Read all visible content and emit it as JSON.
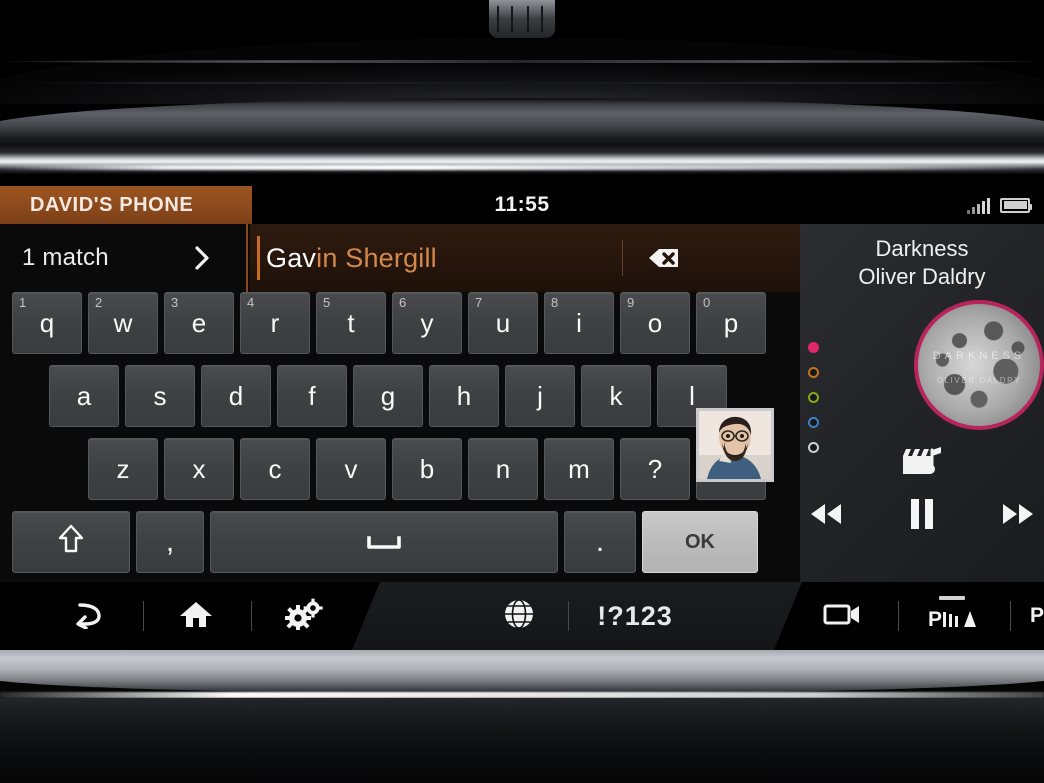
{
  "statusbar": {
    "device_label": "DAVID'S PHONE",
    "clock": "11:55",
    "signal_icon": "signal-bars-icon",
    "battery_icon": "battery-icon"
  },
  "search": {
    "match_count_label": "1 match",
    "chevron_icon": "chevron-right-icon",
    "typed_text": "Gav",
    "suggested_text": "in Shergill",
    "full_value": "Gavin Shergill",
    "backspace_icon": "backspace-delete-icon",
    "avatar_name": "contact-photo"
  },
  "keyboard": {
    "row1": [
      {
        "key": "q",
        "num": "1"
      },
      {
        "key": "w",
        "num": "2"
      },
      {
        "key": "e",
        "num": "3"
      },
      {
        "key": "r",
        "num": "4"
      },
      {
        "key": "t",
        "num": "5"
      },
      {
        "key": "y",
        "num": "6"
      },
      {
        "key": "u",
        "num": "7"
      },
      {
        "key": "i",
        "num": "8"
      },
      {
        "key": "o",
        "num": "9"
      },
      {
        "key": "p",
        "num": "0"
      }
    ],
    "row2": [
      "a",
      "s",
      "d",
      "f",
      "g",
      "h",
      "j",
      "k",
      "l"
    ],
    "row3": [
      "z",
      "x",
      "c",
      "v",
      "b",
      "n",
      "m",
      "?",
      "!"
    ],
    "shift_icon": "shift-arrow-up-icon",
    "comma_label": ",",
    "space_icon": "space-bar-icon",
    "period_label": ".",
    "ok_label": "OK"
  },
  "media": {
    "track_title": "Darkness",
    "track_artist": "Oliver Daldry",
    "album_art_line1": "DARKNESS",
    "album_art_line2": "OLIVER DALDRY",
    "source_icon": "media-clapperboard-note-icon",
    "rewind_icon": "rewind-icon",
    "pause_icon": "pause-icon",
    "forward_icon": "fast-forward-icon",
    "dots": [
      {
        "name": "page-dot-1",
        "color": "#e0276a",
        "filled": true
      },
      {
        "name": "page-dot-2",
        "color": "#c2741f",
        "filled": false
      },
      {
        "name": "page-dot-3",
        "color": "#8aa81c",
        "filled": false
      },
      {
        "name": "page-dot-4",
        "color": "#3f7fc4",
        "filled": false
      },
      {
        "name": "page-dot-5",
        "color": "#cfcfcf",
        "filled": false
      }
    ]
  },
  "navbar": {
    "back_icon": "back-arrow-icon",
    "home_icon": "home-icon",
    "settings_icon": "gears-icon",
    "globe_icon": "globe-language-icon",
    "symbols_label": "!?123",
    "camera_icon": "video-camera-icon",
    "park_assist_icon": "park-assist-icon"
  },
  "colors": {
    "accent_orange": "#8c4a1c",
    "caret": "#c96c22",
    "suggestion_text": "#d4884b",
    "album_ring": "#b8245c",
    "ok_key": "#bcbcbc"
  }
}
